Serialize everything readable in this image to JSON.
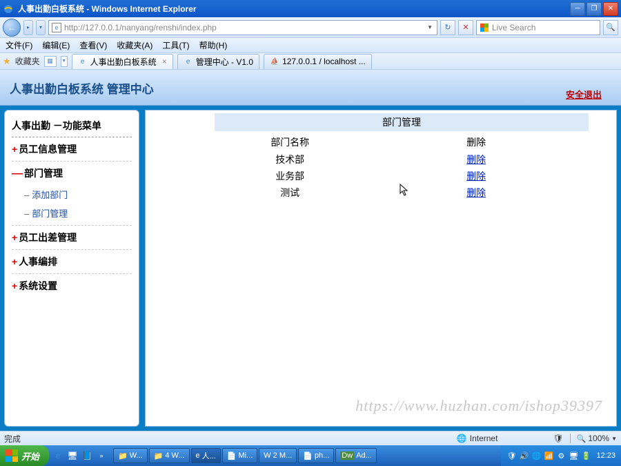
{
  "window": {
    "title": "人事出勤白板系统 - Windows Internet Explorer"
  },
  "address": {
    "url": "http://127.0.0.1/nanyang/renshi/index.php"
  },
  "search": {
    "placeholder": "Live Search"
  },
  "menu": {
    "file": "文件(F)",
    "edit": "编辑(E)",
    "view": "查看(V)",
    "favorites": "收藏夹(A)",
    "tools": "工具(T)",
    "help": "帮助(H)"
  },
  "favbar": {
    "label": "收藏夹"
  },
  "tabs": [
    {
      "label": "人事出勤白板系统",
      "icon": "ie"
    },
    {
      "label": "管理中心 - V1.0",
      "icon": "ie"
    },
    {
      "label": "127.0.0.1 / localhost ...",
      "icon": "pma"
    }
  ],
  "app": {
    "header_title": "人事出勤白板系统 管理中心",
    "logout": "安全退出"
  },
  "sidebar": {
    "title": "人事出勤 －功能菜单",
    "items": [
      {
        "label": "员工信息管理",
        "expanded": false
      },
      {
        "label": "部门管理",
        "expanded": true,
        "children": [
          {
            "label": "添加部门"
          },
          {
            "label": "部门管理"
          }
        ]
      },
      {
        "label": "员工出差管理",
        "expanded": false
      },
      {
        "label": "人事编排",
        "expanded": false
      },
      {
        "label": "系统设置",
        "expanded": false
      }
    ]
  },
  "main": {
    "section_title": "部门管理",
    "columns": {
      "name": "部门名称",
      "action": "删除"
    },
    "rows": [
      {
        "name": "技术部",
        "action": "删除"
      },
      {
        "name": "业务部",
        "action": "删除"
      },
      {
        "name": "测试",
        "action": "删除"
      }
    ]
  },
  "watermark": "https://www.huzhan.com/ishop39397",
  "status": {
    "done": "完成",
    "zone": "Internet",
    "zoom": "100%"
  },
  "taskbar": {
    "start": "开始",
    "items": [
      {
        "label": "W..."
      },
      {
        "label": "4 W..."
      },
      {
        "label": "人..."
      },
      {
        "label": "Mi..."
      },
      {
        "label": "2 M..."
      },
      {
        "label": "ph..."
      },
      {
        "label": "Ad..."
      }
    ],
    "clock": "12:23"
  }
}
